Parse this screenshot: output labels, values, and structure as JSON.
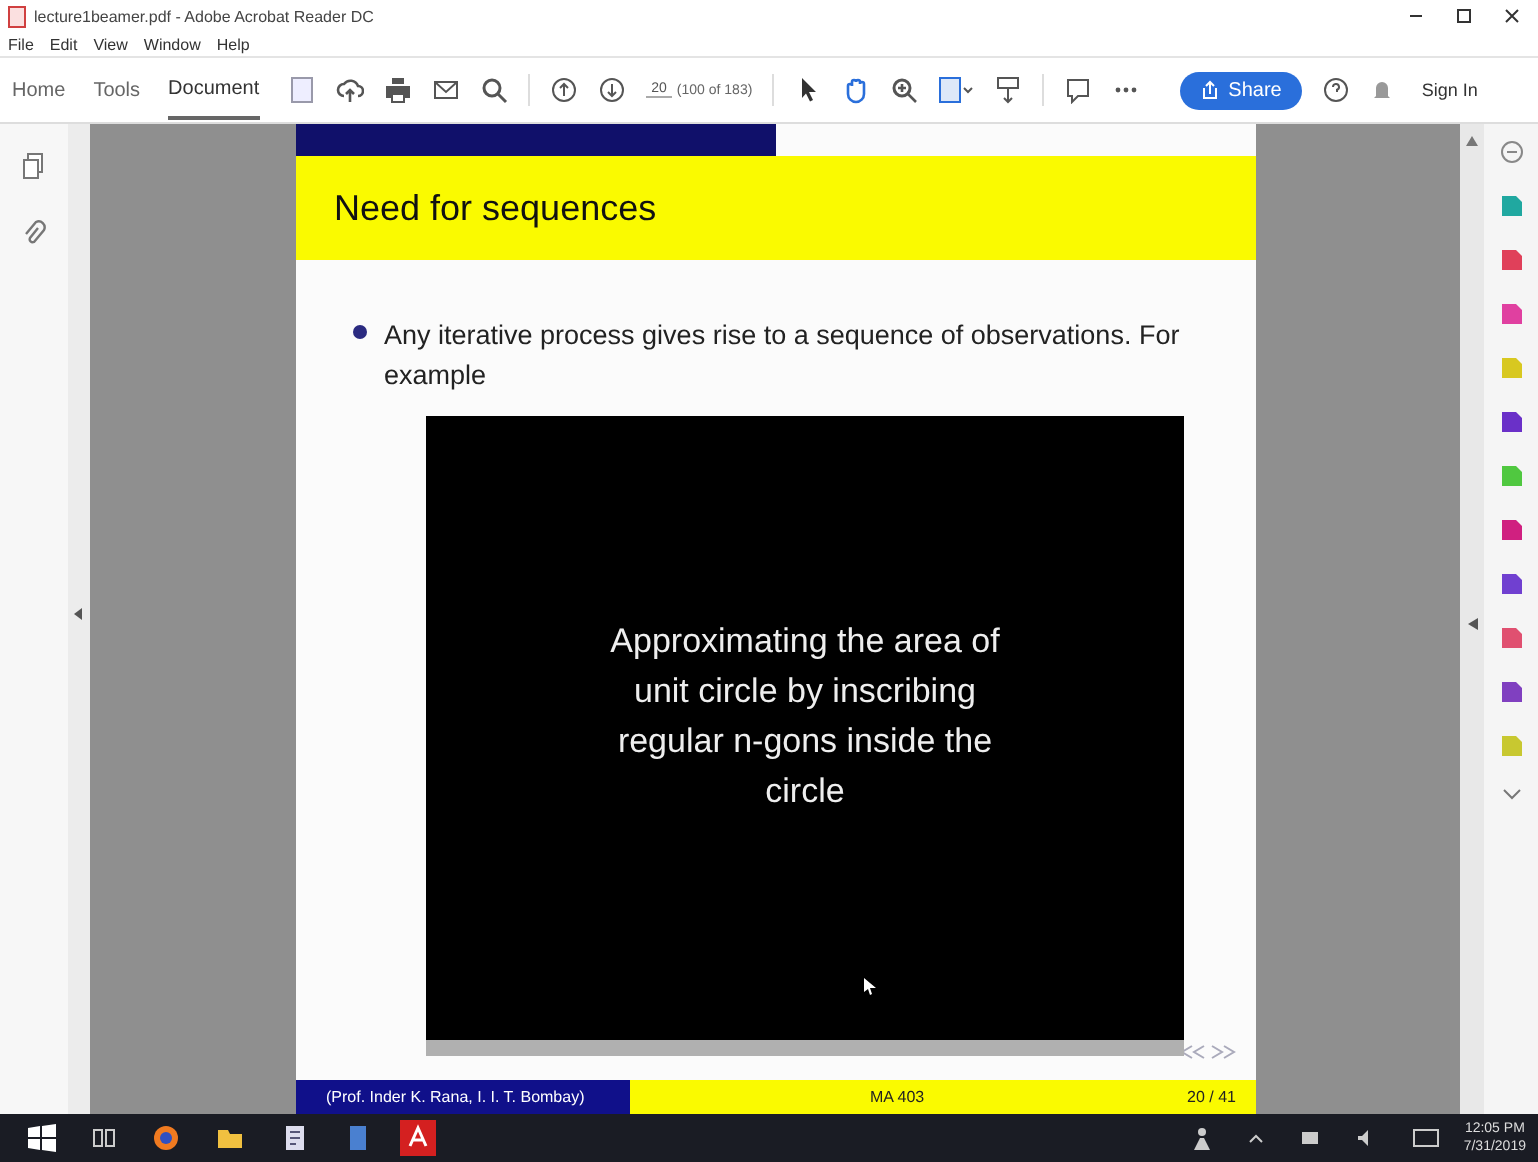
{
  "window": {
    "title": "lecture1beamer.pdf - Adobe Acrobat Reader DC"
  },
  "menu": [
    "File",
    "Edit",
    "View",
    "Window",
    "Help"
  ],
  "tabs": [
    {
      "label": "Home",
      "selected": false
    },
    {
      "label": "Tools",
      "selected": false
    },
    {
      "label": "Document",
      "selected": true
    }
  ],
  "toolbar": {
    "page_number": "20",
    "page_count": "(100 of 183)",
    "share": "Share",
    "sign_in": "Sign In"
  },
  "slide": {
    "title": "Need for sequences",
    "bullet": "Any iterative process gives rise to a sequence of observations. For example",
    "video_text": "Approximating the area of unit circle by inscribing regular n-gons inside the circle",
    "footer": {
      "author": "(Prof. Inder K. Rana, I. I. T. Bombay)",
      "course": "MA 403",
      "page": "20 / 41"
    }
  },
  "tools": [
    {
      "color": "#20a8a0"
    },
    {
      "color": "#e0405a"
    },
    {
      "color": "#e040a0"
    },
    {
      "color": "#d8c820"
    },
    {
      "color": "#6a30c8"
    },
    {
      "color": "#50c840"
    },
    {
      "color": "#d02080"
    },
    {
      "color": "#7040d0"
    },
    {
      "color": "#e05070"
    },
    {
      "color": "#8040c0"
    },
    {
      "color": "#c8c830"
    }
  ],
  "taskbar": {
    "time": "12:05 PM",
    "date": "7/31/2019"
  }
}
